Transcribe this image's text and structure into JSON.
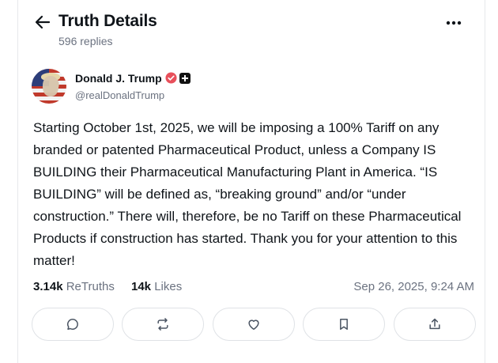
{
  "header": {
    "title": "Truth Details",
    "subtitle": "596 replies",
    "back_icon": "arrow-left-icon",
    "more_icon": "more-horizontal-icon"
  },
  "post": {
    "author": {
      "name": "Donald J. Trump",
      "handle": "@realDonaldTrump",
      "verified_color": "#e8505b"
    },
    "text": "Starting October 1st, 2025, we will be imposing a 100% Tariff on any branded or patented Pharmaceutical Product, unless a Company IS BUILDING their Pharmaceutical Manufacturing Plant in America. “IS BUILDING” will be defined as, “breaking ground” and/or “under construction.” There will, therefore, be no Tariff on these Pharmaceutical Products if construction has started. Thank you for your attention to this matter!",
    "stats": {
      "retruths_count": "3.14k",
      "retruths_label": "ReTruths",
      "likes_count": "14k",
      "likes_label": "Likes"
    },
    "timestamp": "Sep 26, 2025, 9:24 AM"
  },
  "actions": [
    {
      "icon": "reply-icon"
    },
    {
      "icon": "retruth-icon"
    },
    {
      "icon": "like-icon"
    },
    {
      "icon": "bookmark-icon"
    },
    {
      "icon": "share-icon"
    }
  ]
}
